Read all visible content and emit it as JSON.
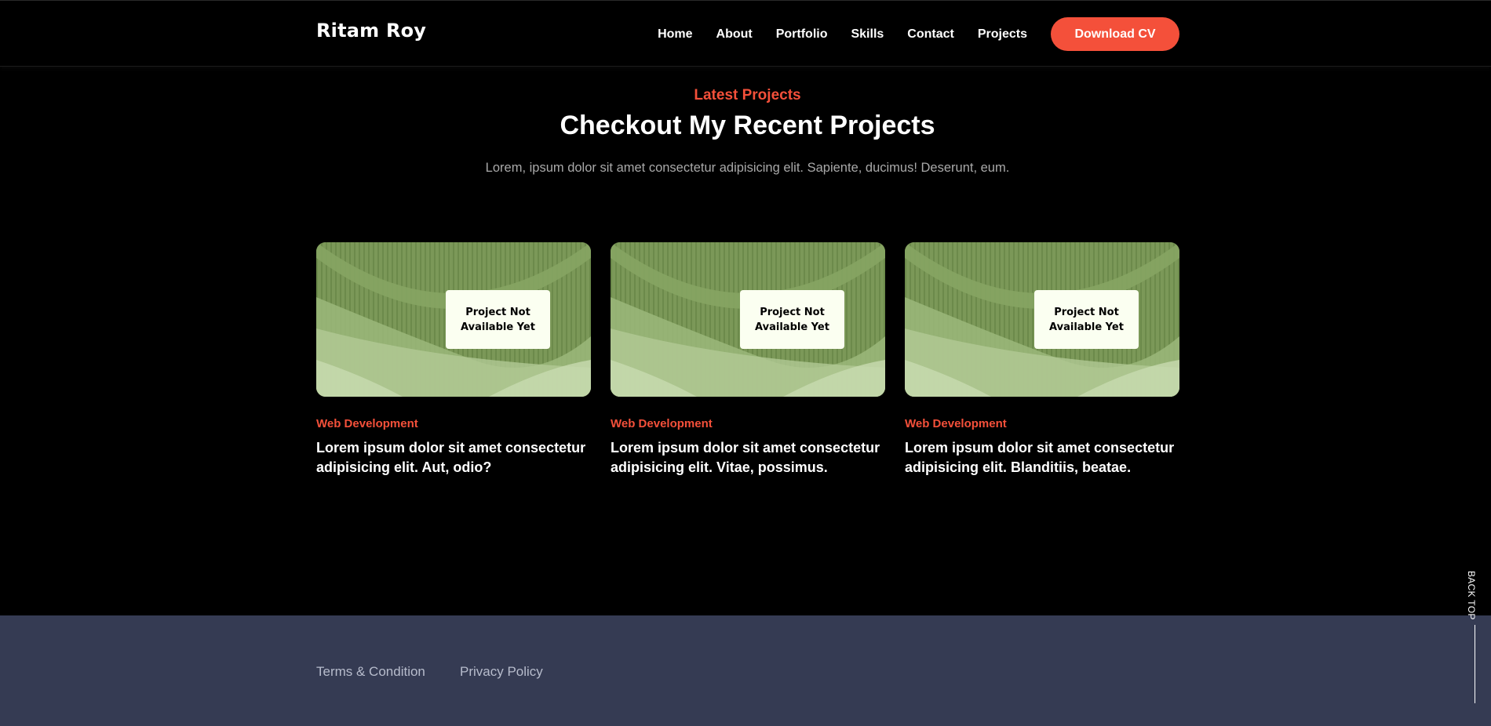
{
  "header": {
    "brand": "Ritam Roy",
    "nav": [
      "Home",
      "About",
      "Portfolio",
      "Skills",
      "Contact",
      "Projects"
    ],
    "cta_label": "Download CV",
    "accent_color": "#f4503a"
  },
  "section": {
    "eyebrow": "Latest Projects",
    "title": "Checkout My Recent Projects",
    "description": "Lorem, ipsum dolor sit amet consectetur adipisicing elit. Sapiente, ducimus! Deserunt, eum."
  },
  "projects": [
    {
      "badge": "Project Not Available Yet",
      "category": "Web Development",
      "title": "Lorem ipsum dolor sit amet consectetur adipisicing elit. Aut, odio?"
    },
    {
      "badge": "Project Not Available Yet",
      "category": "Web Development",
      "title": "Lorem ipsum dolor sit amet consectetur adipisicing elit. Vitae, possimus."
    },
    {
      "badge": "Project Not Available Yet",
      "category": "Web Development",
      "title": "Lorem ipsum dolor sit amet consectetur adipisicing elit. Blanditiis, beatae."
    }
  ],
  "footer": {
    "links": [
      "Terms & Condition",
      "Privacy Policy"
    ],
    "background": "#353b53"
  },
  "back_top": {
    "label": "BACK TOP"
  }
}
